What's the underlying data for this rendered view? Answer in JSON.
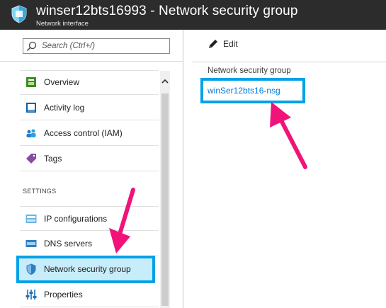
{
  "header": {
    "title": "winser12bts16993 - Network security group",
    "subtitle": "Network interface",
    "logo_icon": "shield-icon",
    "background": "#2c2c2c"
  },
  "sidebar": {
    "search_placeholder": "Search (Ctrl+/)",
    "items": [
      {
        "label": "Overview",
        "icon": "overview-icon"
      },
      {
        "label": "Activity log",
        "icon": "activity-log-icon"
      },
      {
        "label": "Access control (IAM)",
        "icon": "access-control-icon"
      },
      {
        "label": "Tags",
        "icon": "tag-icon"
      }
    ],
    "section_label": "SETTINGS",
    "settings_items": [
      {
        "label": "IP configurations",
        "icon": "ip-configurations-icon"
      },
      {
        "label": "DNS servers",
        "icon": "dns-servers-icon"
      },
      {
        "label": "Network security group",
        "icon": "network-security-group-icon",
        "selected": true
      },
      {
        "label": "Properties",
        "icon": "properties-icon"
      }
    ]
  },
  "main": {
    "edit_label": "Edit",
    "field_label": "Network security group",
    "field_value": "winSer12bts16-nsg"
  },
  "colors": {
    "highlight_border": "#00a2e8",
    "selected_bg": "#c7ecfa",
    "link": "#0078d7",
    "annotation_arrow": "#f0147a"
  }
}
